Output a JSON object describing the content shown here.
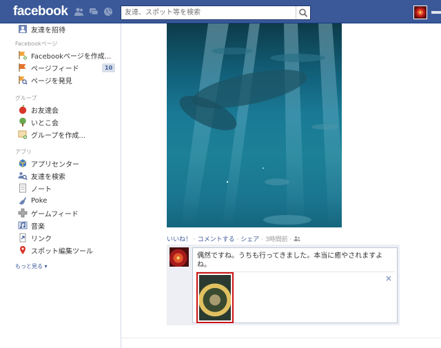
{
  "app": {
    "logo": "facebook"
  },
  "search": {
    "placeholder": "友達、スポット等を検索"
  },
  "sidebar": {
    "invite_label": "友達を招待",
    "sections": {
      "pages": "Facebookページ",
      "groups": "グループ",
      "apps": "アプリ"
    },
    "page_items": [
      {
        "label": "Facebookページを作成...",
        "icon": "flag-create-icon"
      },
      {
        "label": "ページフィード",
        "icon": "flag-feed-icon",
        "count": "10"
      },
      {
        "label": "ページを発見",
        "icon": "pages-discover-icon"
      }
    ],
    "group_items": [
      {
        "label": "お友達会",
        "icon": "apple-icon"
      },
      {
        "label": "いとこ会",
        "icon": "tree-icon"
      },
      {
        "label": "グループを作成...",
        "icon": "group-create-icon"
      }
    ],
    "app_items": [
      {
        "label": "アプリセンター",
        "icon": "app-center-icon"
      },
      {
        "label": "友達を検索",
        "icon": "find-friends-icon"
      },
      {
        "label": "ノート",
        "icon": "notes-icon"
      },
      {
        "label": "Poke",
        "icon": "poke-icon"
      },
      {
        "label": "ゲームフィード",
        "icon": "game-feed-icon"
      },
      {
        "label": "音楽",
        "icon": "music-icon"
      },
      {
        "label": "リンク",
        "icon": "link-icon"
      },
      {
        "label": "スポット編集ツール",
        "icon": "place-editor-icon"
      }
    ],
    "more_label": "もっと見る"
  },
  "post": {
    "like_label": "いいね！",
    "comment_label": "コメントする",
    "share_label": "シェア",
    "time_label": "3時間前"
  },
  "comment": {
    "text": "偶然ですね。うちも行ってきました。本当に癒やされますよね。",
    "close_label": "×"
  },
  "colors": {
    "brand": "#3b5998",
    "attachment_border": "#cc1111"
  }
}
